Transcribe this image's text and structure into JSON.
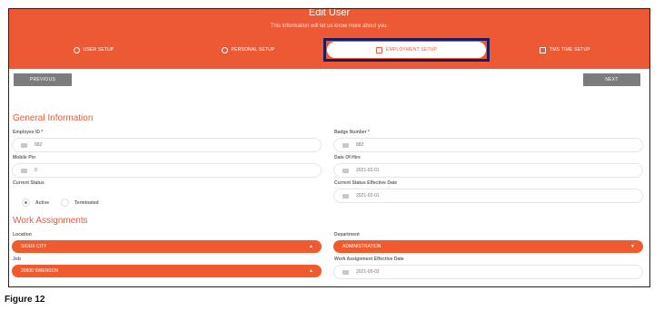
{
  "header": {
    "title": "Edit User",
    "subtitle": "This information will let us know more about you.",
    "tabs": [
      {
        "label": "USER SETUP",
        "icon": "user-circle-icon"
      },
      {
        "label": "PERSONAL SETUP",
        "icon": "info-circle-icon"
      },
      {
        "label": "EMPLOYMENT SETUP",
        "icon": "briefcase-icon",
        "active": true
      },
      {
        "label": "TMS TIME SETUP",
        "icon": "alarm-clock-icon"
      }
    ]
  },
  "nav": {
    "previous_label": "PREVIOUS",
    "next_label": "NEXT"
  },
  "general": {
    "heading": "General Information",
    "employee_id_label": "Employee ID *",
    "employee_id_value": "882",
    "badge_label": "Badge Number *",
    "badge_value": "882",
    "mobile_pin_label": "Mobile Pin",
    "mobile_pin_value": "0",
    "date_of_hire_label": "Date Of Hire",
    "date_of_hire_value": "2021-02-01",
    "status_label": "Current Status",
    "status_active": "Active",
    "status_terminated": "Terminated",
    "status_selected": "Active",
    "status_eff_label": "Current Status Effective Date",
    "status_eff_value": "2021-02-01"
  },
  "work": {
    "heading": "Work Assignments",
    "location_label": "Location",
    "location_value": "SIOUX CITY",
    "department_label": "Department",
    "department_value": "ADMINISTRATION",
    "job_label": "Job",
    "job_value": "20900 SWENSON",
    "wa_eff_label": "Work Assignment Effective Date",
    "wa_eff_value": "2021-05-03"
  },
  "caption": "Figure 12",
  "colors": {
    "accent": "#ec5a35",
    "focus": "#1e1a5c",
    "button": "#7c7c7c"
  }
}
